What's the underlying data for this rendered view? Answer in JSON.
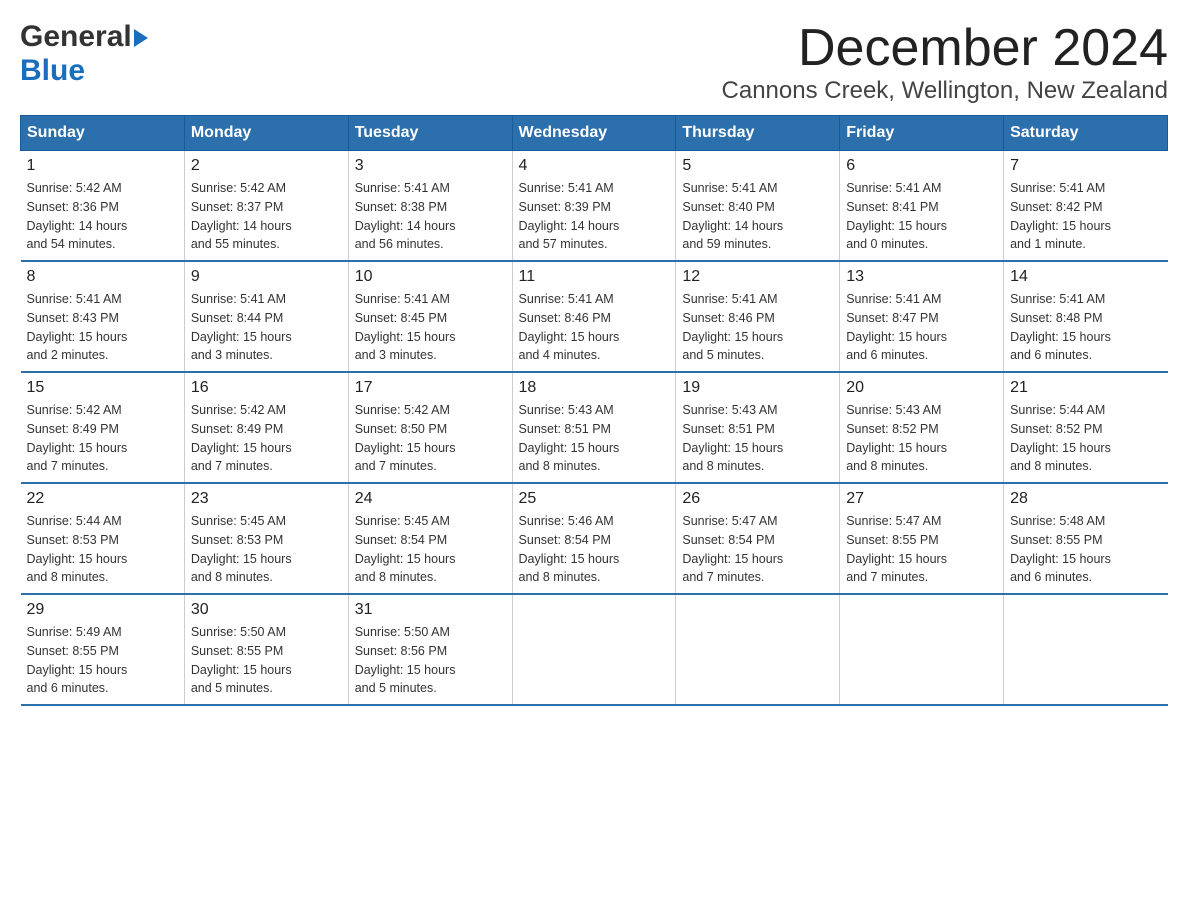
{
  "logo": {
    "top": "General",
    "bottom": "Blue"
  },
  "header": {
    "month": "December 2024",
    "location": "Cannons Creek, Wellington, New Zealand"
  },
  "weekdays": [
    "Sunday",
    "Monday",
    "Tuesday",
    "Wednesday",
    "Thursday",
    "Friday",
    "Saturday"
  ],
  "weeks": [
    [
      {
        "day": "1",
        "sunrise": "5:42 AM",
        "sunset": "8:36 PM",
        "daylight": "14 hours and 54 minutes."
      },
      {
        "day": "2",
        "sunrise": "5:42 AM",
        "sunset": "8:37 PM",
        "daylight": "14 hours and 55 minutes."
      },
      {
        "day": "3",
        "sunrise": "5:41 AM",
        "sunset": "8:38 PM",
        "daylight": "14 hours and 56 minutes."
      },
      {
        "day": "4",
        "sunrise": "5:41 AM",
        "sunset": "8:39 PM",
        "daylight": "14 hours and 57 minutes."
      },
      {
        "day": "5",
        "sunrise": "5:41 AM",
        "sunset": "8:40 PM",
        "daylight": "14 hours and 59 minutes."
      },
      {
        "day": "6",
        "sunrise": "5:41 AM",
        "sunset": "8:41 PM",
        "daylight": "15 hours and 0 minutes."
      },
      {
        "day": "7",
        "sunrise": "5:41 AM",
        "sunset": "8:42 PM",
        "daylight": "15 hours and 1 minute."
      }
    ],
    [
      {
        "day": "8",
        "sunrise": "5:41 AM",
        "sunset": "8:43 PM",
        "daylight": "15 hours and 2 minutes."
      },
      {
        "day": "9",
        "sunrise": "5:41 AM",
        "sunset": "8:44 PM",
        "daylight": "15 hours and 3 minutes."
      },
      {
        "day": "10",
        "sunrise": "5:41 AM",
        "sunset": "8:45 PM",
        "daylight": "15 hours and 3 minutes."
      },
      {
        "day": "11",
        "sunrise": "5:41 AM",
        "sunset": "8:46 PM",
        "daylight": "15 hours and 4 minutes."
      },
      {
        "day": "12",
        "sunrise": "5:41 AM",
        "sunset": "8:46 PM",
        "daylight": "15 hours and 5 minutes."
      },
      {
        "day": "13",
        "sunrise": "5:41 AM",
        "sunset": "8:47 PM",
        "daylight": "15 hours and 6 minutes."
      },
      {
        "day": "14",
        "sunrise": "5:41 AM",
        "sunset": "8:48 PM",
        "daylight": "15 hours and 6 minutes."
      }
    ],
    [
      {
        "day": "15",
        "sunrise": "5:42 AM",
        "sunset": "8:49 PM",
        "daylight": "15 hours and 7 minutes."
      },
      {
        "day": "16",
        "sunrise": "5:42 AM",
        "sunset": "8:49 PM",
        "daylight": "15 hours and 7 minutes."
      },
      {
        "day": "17",
        "sunrise": "5:42 AM",
        "sunset": "8:50 PM",
        "daylight": "15 hours and 7 minutes."
      },
      {
        "day": "18",
        "sunrise": "5:43 AM",
        "sunset": "8:51 PM",
        "daylight": "15 hours and 8 minutes."
      },
      {
        "day": "19",
        "sunrise": "5:43 AM",
        "sunset": "8:51 PM",
        "daylight": "15 hours and 8 minutes."
      },
      {
        "day": "20",
        "sunrise": "5:43 AM",
        "sunset": "8:52 PM",
        "daylight": "15 hours and 8 minutes."
      },
      {
        "day": "21",
        "sunrise": "5:44 AM",
        "sunset": "8:52 PM",
        "daylight": "15 hours and 8 minutes."
      }
    ],
    [
      {
        "day": "22",
        "sunrise": "5:44 AM",
        "sunset": "8:53 PM",
        "daylight": "15 hours and 8 minutes."
      },
      {
        "day": "23",
        "sunrise": "5:45 AM",
        "sunset": "8:53 PM",
        "daylight": "15 hours and 8 minutes."
      },
      {
        "day": "24",
        "sunrise": "5:45 AM",
        "sunset": "8:54 PM",
        "daylight": "15 hours and 8 minutes."
      },
      {
        "day": "25",
        "sunrise": "5:46 AM",
        "sunset": "8:54 PM",
        "daylight": "15 hours and 8 minutes."
      },
      {
        "day": "26",
        "sunrise": "5:47 AM",
        "sunset": "8:54 PM",
        "daylight": "15 hours and 7 minutes."
      },
      {
        "day": "27",
        "sunrise": "5:47 AM",
        "sunset": "8:55 PM",
        "daylight": "15 hours and 7 minutes."
      },
      {
        "day": "28",
        "sunrise": "5:48 AM",
        "sunset": "8:55 PM",
        "daylight": "15 hours and 6 minutes."
      }
    ],
    [
      {
        "day": "29",
        "sunrise": "5:49 AM",
        "sunset": "8:55 PM",
        "daylight": "15 hours and 6 minutes."
      },
      {
        "day": "30",
        "sunrise": "5:50 AM",
        "sunset": "8:55 PM",
        "daylight": "15 hours and 5 minutes."
      },
      {
        "day": "31",
        "sunrise": "5:50 AM",
        "sunset": "8:56 PM",
        "daylight": "15 hours and 5 minutes."
      },
      null,
      null,
      null,
      null
    ]
  ],
  "labels": {
    "sunrise": "Sunrise:",
    "sunset": "Sunset:",
    "daylight": "Daylight:"
  }
}
